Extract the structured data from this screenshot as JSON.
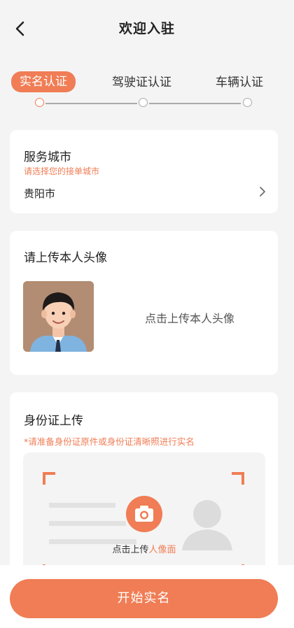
{
  "header": {
    "title": "欢迎入驻"
  },
  "steps": [
    {
      "label": "实名认证",
      "active": true
    },
    {
      "label": "驾驶证认证",
      "active": false
    },
    {
      "label": "车辆认证",
      "active": false
    }
  ],
  "service_city": {
    "title": "服务城市",
    "hint": "请选择您的接单城市",
    "value": "贵阳市"
  },
  "avatar_section": {
    "title": "请上传本人头像",
    "upload_text": "点击上传本人头像"
  },
  "id_section": {
    "title": "身份证上传",
    "hint": "*请准备身份证原件或身份证清晰照进行实名",
    "upload_prefix": "点击上传",
    "upload_side": "人像面"
  },
  "bottom": {
    "start_button": "开始实名"
  },
  "colors": {
    "accent": "#f07d55",
    "background": "#f4f4f4"
  }
}
